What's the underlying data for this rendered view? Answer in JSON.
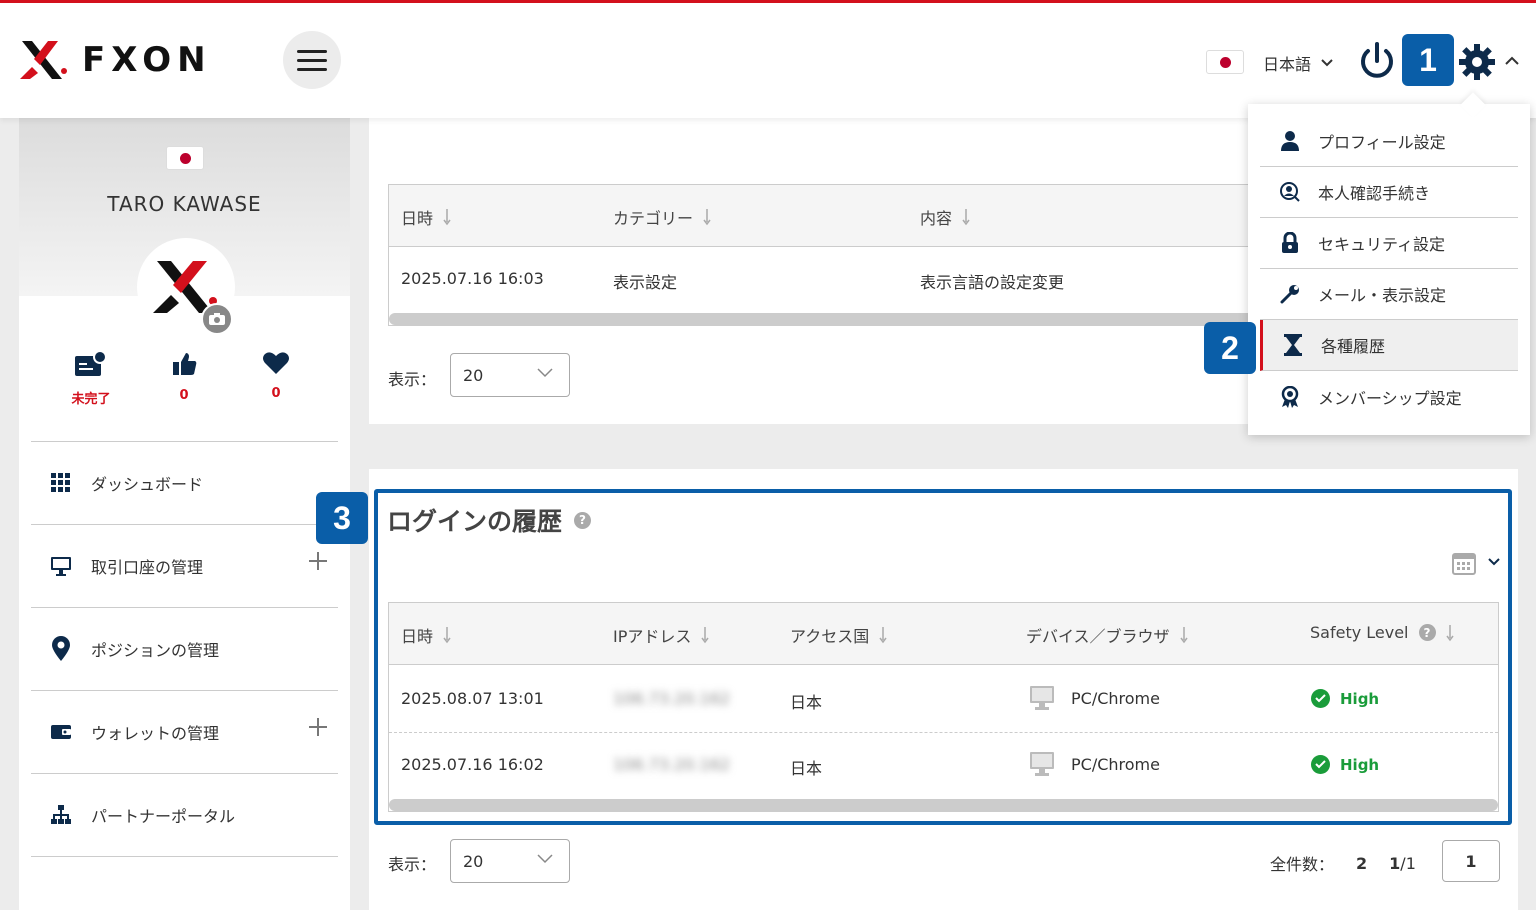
{
  "header": {
    "logo_text": "FXON",
    "language": "日本語"
  },
  "callouts": [
    "1",
    "2",
    "3"
  ],
  "settings_menu": {
    "items": [
      {
        "label": "プロフィール設定",
        "icon": "user-icon"
      },
      {
        "label": "本人確認手続き",
        "icon": "id-badge-icon"
      },
      {
        "label": "セキュリティ設定",
        "icon": "lock-icon"
      },
      {
        "label": "メール・表示設定",
        "icon": "wrench-icon"
      },
      {
        "label": "各種履歴",
        "icon": "hourglass-icon"
      },
      {
        "label": "メンバーシップ設定",
        "icon": "award-icon"
      }
    ]
  },
  "sidebar": {
    "user_name": "TARO KAWASE",
    "stats": [
      {
        "icon": "id-card-icon",
        "value": "未完了"
      },
      {
        "icon": "thumbs-up-icon",
        "value": "0"
      },
      {
        "icon": "heart-icon",
        "value": "0"
      }
    ],
    "nav": [
      {
        "label": "ダッシュボード",
        "icon": "grid-icon"
      },
      {
        "label": "取引口座の管理",
        "icon": "monitor-icon"
      },
      {
        "label": "ポジションの管理",
        "icon": "map-pin-icon"
      },
      {
        "label": "ウォレットの管理",
        "icon": "wallet-icon"
      },
      {
        "label": "パートナーポータル",
        "icon": "sitemap-icon"
      }
    ]
  },
  "history_table": {
    "headers": [
      "日時",
      "カテゴリー",
      "内容"
    ],
    "rows": [
      {
        "datetime": "2025.07.16 16:03",
        "category": "表示設定",
        "content": "表示言語の設定変更"
      }
    ],
    "display_label": "表示：",
    "page_size": "20"
  },
  "login_history": {
    "title": "ログインの履歴",
    "headers": [
      "日時",
      "IPアドレス",
      "アクセス国",
      "デバイス／ブラウザ",
      "Safety Level"
    ],
    "rows": [
      {
        "datetime": "2025.08.07 13:01",
        "ip": "106.73.20.162",
        "country": "日本",
        "device": "PC/Chrome",
        "safety": "High"
      },
      {
        "datetime": "2025.07.16 16:02",
        "ip": "106.73.20.162",
        "country": "日本",
        "device": "PC/Chrome",
        "safety": "High"
      }
    ],
    "display_label": "表示：",
    "page_size": "20",
    "total_label": "全件数：",
    "total_count": "2",
    "page_indicator_current": "1",
    "page_indicator_total": "/1",
    "page_button": "1"
  },
  "colors": {
    "brand_red": "#d3101c",
    "callout_blue": "#0a5ea8",
    "safe_green": "#1a9c3a"
  }
}
